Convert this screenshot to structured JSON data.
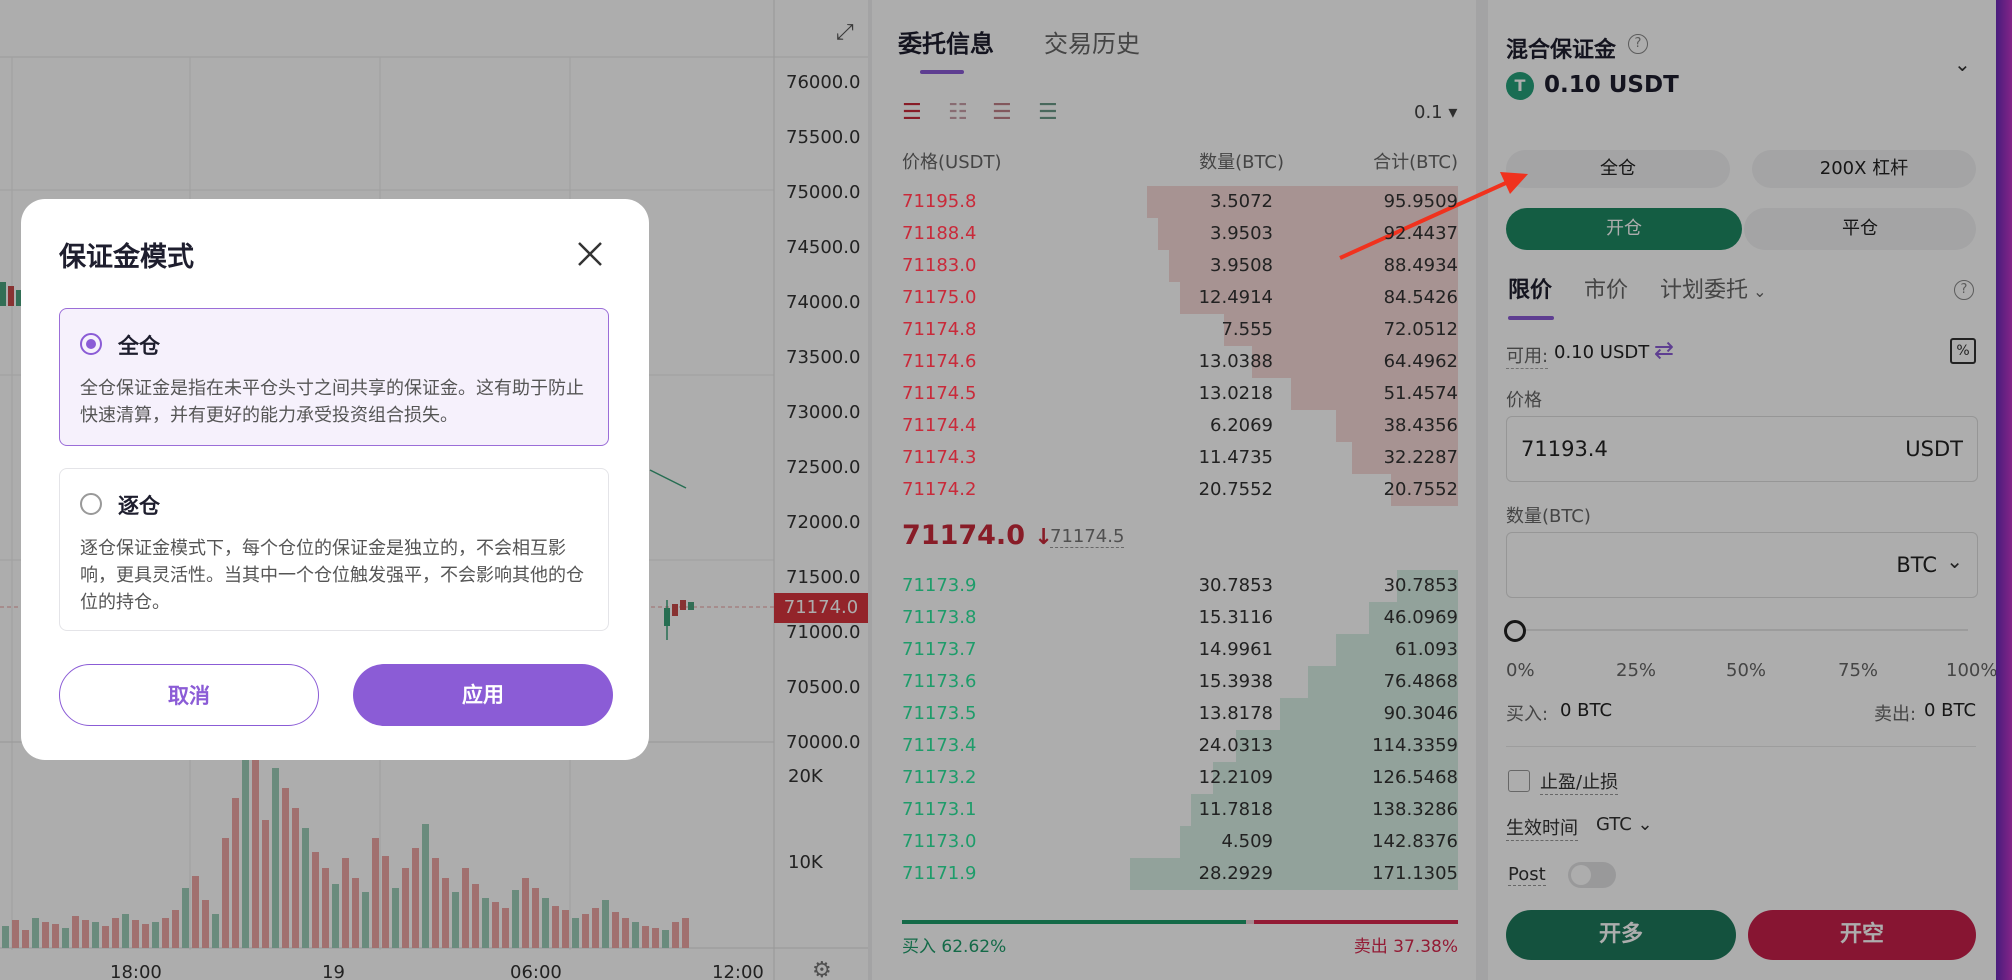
{
  "chart": {
    "price_ticks": [
      "76000.0",
      "75500.0",
      "75000.0",
      "74500.0",
      "74000.0",
      "73500.0",
      "73000.0",
      "72500.0",
      "72000.0",
      "71500.0",
      "71000.0",
      "70500.0",
      "70000.0"
    ],
    "current_price_tag": "71174.0",
    "volume_ticks": [
      "20K",
      "10K"
    ],
    "time_ticks": [
      "18:00",
      "19",
      "06:00",
      "12:00"
    ]
  },
  "orderbook": {
    "tabs": [
      "委托信息",
      "交易历史"
    ],
    "precision": "0.1",
    "headers": {
      "price": "价格(USDT)",
      "qty": "数量(BTC)",
      "total": "合计(BTC)"
    },
    "asks": [
      {
        "p": "71195.8",
        "q": "3.5072",
        "t": "95.9509",
        "depth": 0.56
      },
      {
        "p": "71188.4",
        "q": "3.9503",
        "t": "92.4437",
        "depth": 0.54
      },
      {
        "p": "71183.0",
        "q": "3.9508",
        "t": "88.4934",
        "depth": 0.52
      },
      {
        "p": "71175.0",
        "q": "12.4914",
        "t": "84.5426",
        "depth": 0.5
      },
      {
        "p": "71174.8",
        "q": "7.555",
        "t": "72.0512",
        "depth": 0.42
      },
      {
        "p": "71174.6",
        "q": "13.0388",
        "t": "64.4962",
        "depth": 0.37
      },
      {
        "p": "71174.5",
        "q": "13.0218",
        "t": "51.4574",
        "depth": 0.3
      },
      {
        "p": "71174.4",
        "q": "6.2069",
        "t": "38.4356",
        "depth": 0.22
      },
      {
        "p": "71174.3",
        "q": "11.4735",
        "t": "32.2287",
        "depth": 0.19
      },
      {
        "p": "71174.2",
        "q": "20.7552",
        "t": "20.7552",
        "depth": 0.12
      }
    ],
    "last_price": "71174.0",
    "last_price_arrow": "↓",
    "mark_price": "71174.5",
    "bids": [
      {
        "p": "71173.9",
        "q": "30.7853",
        "t": "30.7853",
        "depth": 0.11
      },
      {
        "p": "71173.8",
        "q": "15.3116",
        "t": "46.0969",
        "depth": 0.16
      },
      {
        "p": "71173.7",
        "q": "14.9961",
        "t": "61.093",
        "depth": 0.22
      },
      {
        "p": "71173.6",
        "q": "15.3938",
        "t": "76.4868",
        "depth": 0.27
      },
      {
        "p": "71173.5",
        "q": "13.8178",
        "t": "90.3046",
        "depth": 0.32
      },
      {
        "p": "71173.4",
        "q": "24.0313",
        "t": "114.3359",
        "depth": 0.4
      },
      {
        "p": "71173.2",
        "q": "12.2109",
        "t": "126.5468",
        "depth": 0.44
      },
      {
        "p": "71173.1",
        "q": "11.7818",
        "t": "138.3286",
        "depth": 0.48
      },
      {
        "p": "71173.0",
        "q": "4.509",
        "t": "142.8376",
        "depth": 0.5
      },
      {
        "p": "71171.9",
        "q": "28.2929",
        "t": "171.1305",
        "depth": 0.59
      }
    ],
    "buy_ratio": "买入 62.62%",
    "sell_ratio": "卖出 37.38%",
    "buy_fraction": 0.6262
  },
  "form": {
    "title": "混合保证金",
    "balance": "0.10 USDT",
    "coin_icon_letter": "T",
    "margin_mode": "全仓",
    "leverage": "200X 杠杆",
    "open_tab": "开仓",
    "close_tab": "平仓",
    "order_types": [
      "限价",
      "市价",
      "计划委托"
    ],
    "available_label": "可用:",
    "available_value": "0.10 USDT",
    "price_label": "价格",
    "price_value": "71193.4",
    "price_unit": "USDT",
    "qty_label": "数量(BTC)",
    "qty_unit": "BTC",
    "slider_marks": [
      "0%",
      "25%",
      "50%",
      "75%",
      "100%"
    ],
    "buy_label": "买入:",
    "buy_value": "0 BTC",
    "sell_label": "卖出:",
    "sell_value": "0 BTC",
    "tpsl_label": "止盈/止损",
    "tif_label": "生效时间",
    "tif_value": "GTC",
    "post_label": "Post",
    "long_button": "开多",
    "short_button": "开空"
  },
  "modal": {
    "title": "保证金模式",
    "options": [
      {
        "title": "全仓",
        "desc": "全仓保证金是指在未平仓头寸之间共享的保证金。这有助于防止快速清算，并有更好的能力承受投资组合损失。",
        "selected": true
      },
      {
        "title": "逐仓",
        "desc": "逐仓保证金模式下，每个仓位的保证金是独立的，不会相互影响，更具灵活性。当其中一个仓位触发强平，不会影响其他的仓位的持仓。",
        "selected": false
      }
    ],
    "cancel": "取消",
    "apply": "应用"
  },
  "colors": {
    "accent": "#8b5cd6",
    "buy": "#1e8a64",
    "sell": "#c8204a"
  }
}
